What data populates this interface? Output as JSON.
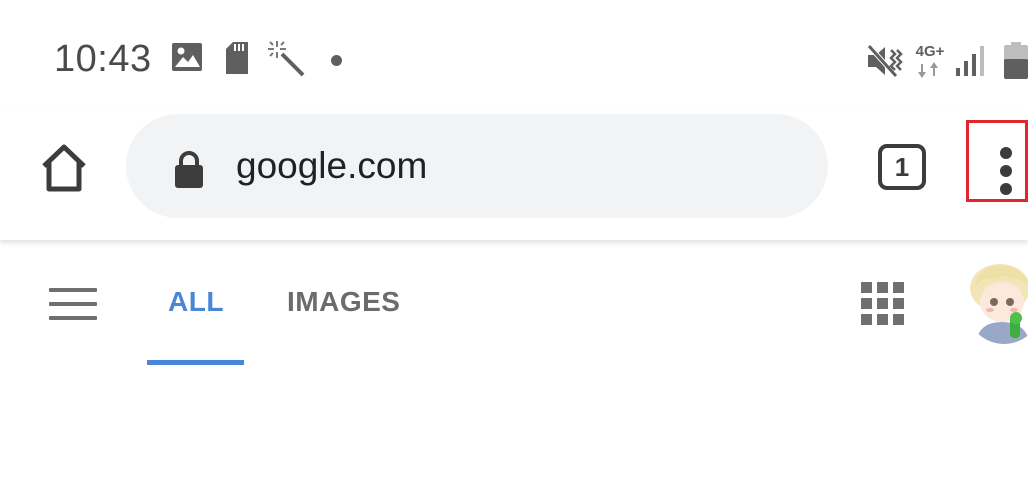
{
  "status_bar": {
    "time": "10:43",
    "network_label": "4G+",
    "icons": [
      "gallery-icon",
      "sd-card-icon",
      "magic-wand-icon",
      "notification-dot-icon",
      "vibrate-mute-icon",
      "signal-icon",
      "battery-icon"
    ]
  },
  "toolbar": {
    "url": "google.com",
    "tab_count": "1",
    "icons": [
      "home-icon",
      "lock-icon",
      "more-vert-icon"
    ]
  },
  "google_header": {
    "tabs": [
      {
        "label": "ALL",
        "selected": true
      },
      {
        "label": "IMAGES",
        "selected": false
      }
    ],
    "icons": [
      "hamburger-menu-icon",
      "apps-grid-icon",
      "avatar"
    ]
  },
  "colors": {
    "accent": "#4a86d8",
    "highlight_box": "#e0262e",
    "omnibox_bg": "#f1f3f4"
  }
}
